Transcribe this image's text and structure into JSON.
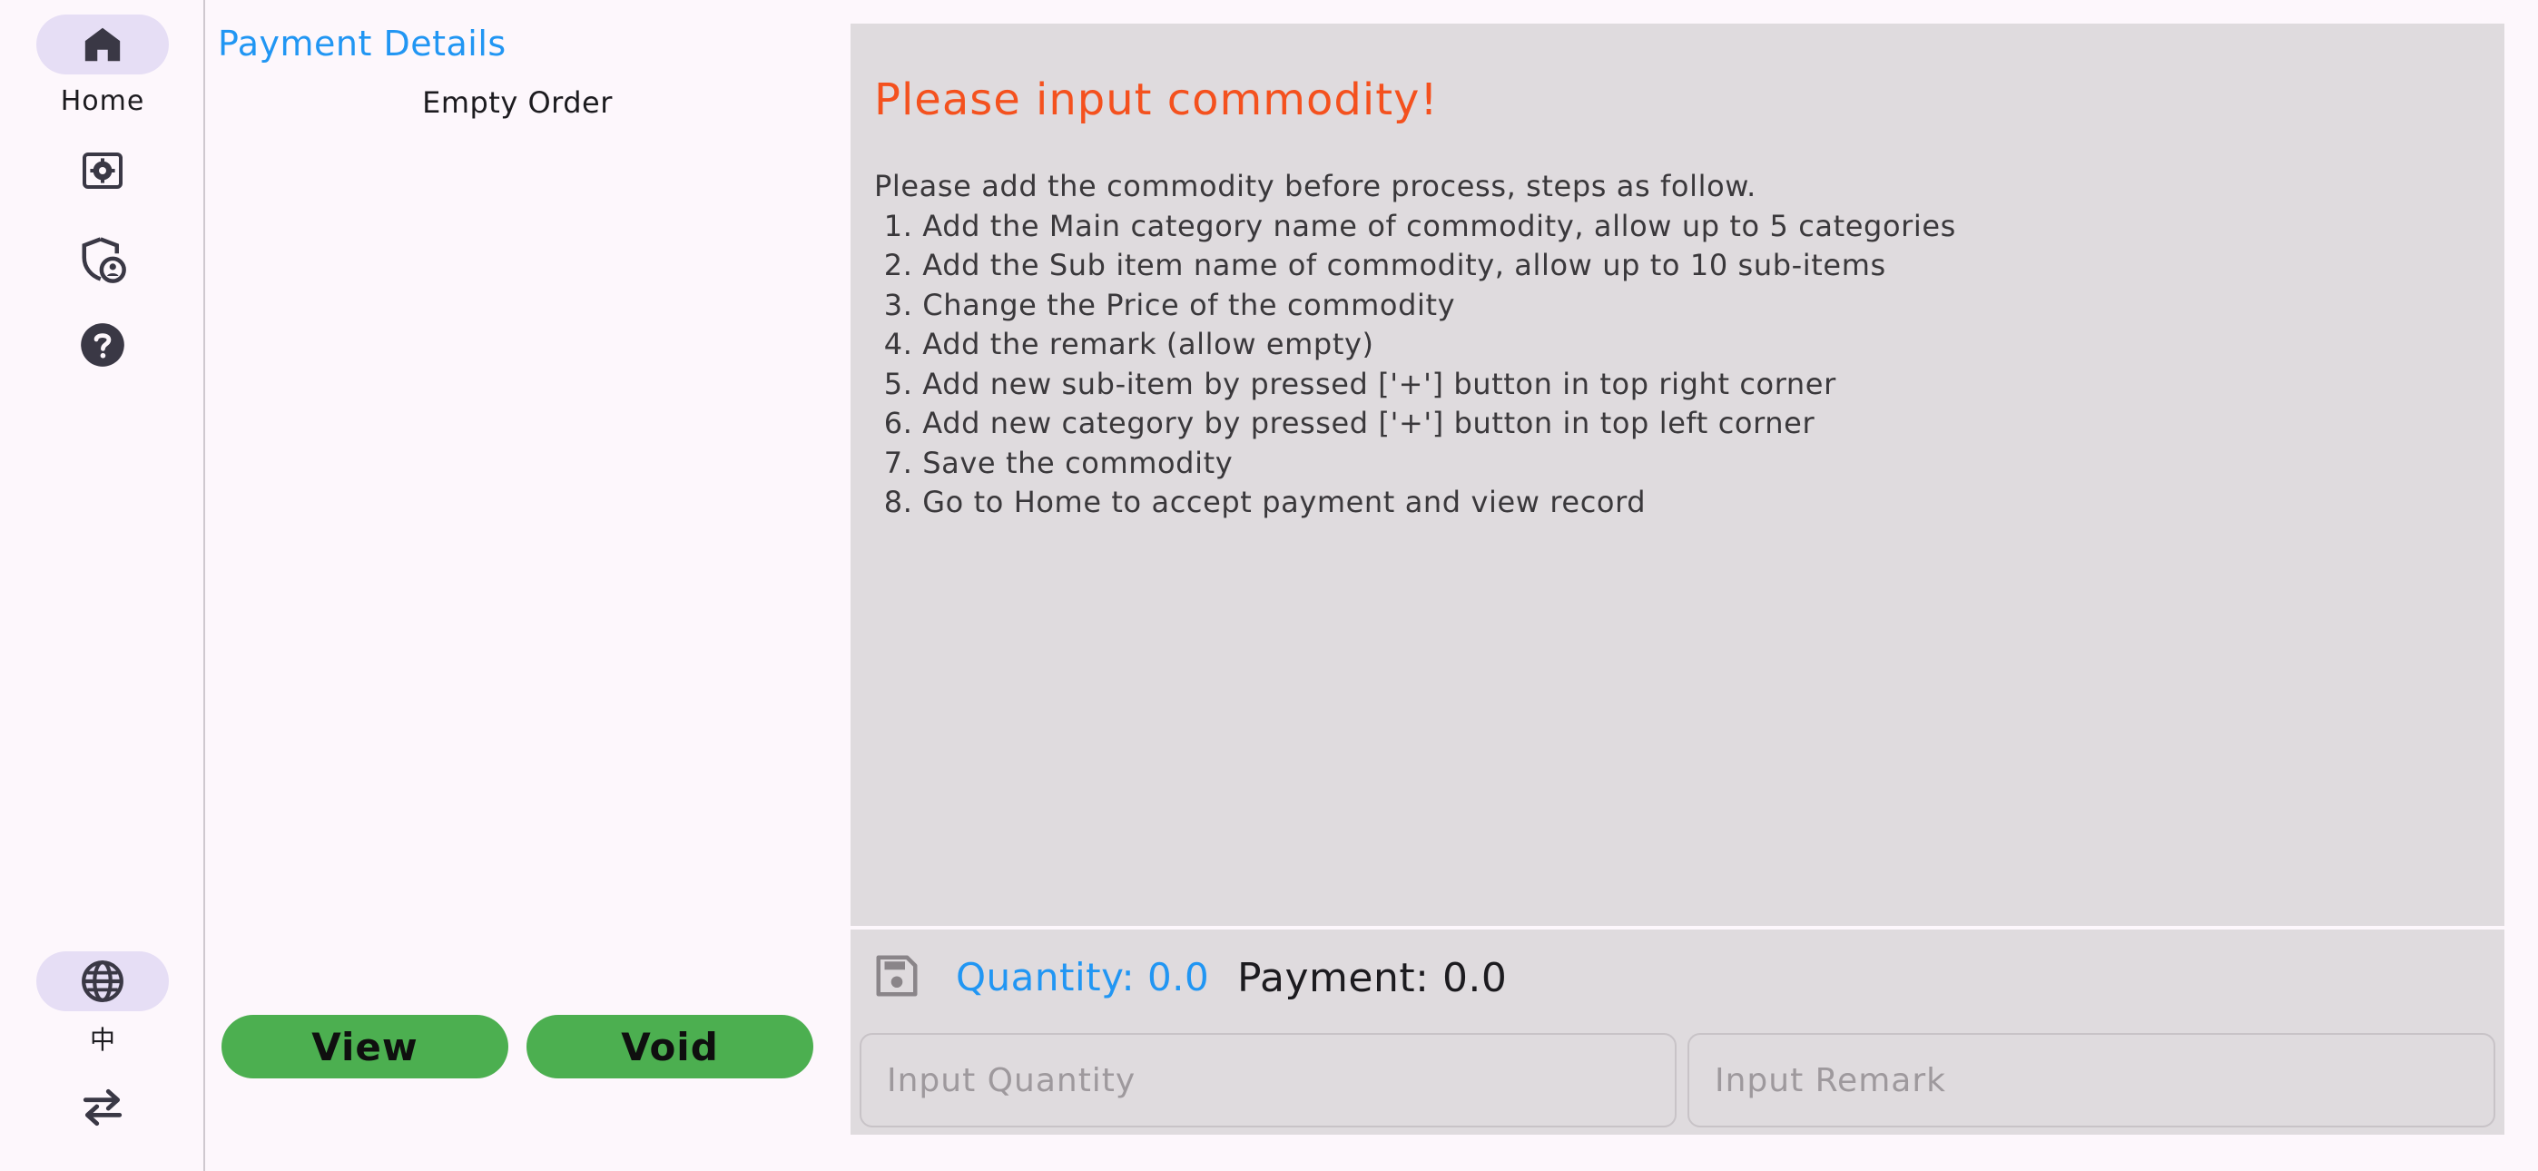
{
  "nav": {
    "home_label": "Home",
    "lang_label": "中",
    "icons": [
      "home-icon",
      "settings-icon",
      "admin-shield-icon",
      "help-icon",
      "globe-icon",
      "swap-icon"
    ],
    "accent_pill": "#e6def5"
  },
  "order_panel": {
    "title": "Payment Details",
    "empty_text": "Empty Order",
    "view_label": "View",
    "void_label": "Void",
    "button_color": "#4caf50"
  },
  "main": {
    "title": "Please input commodity!",
    "intro": "Please add the commodity before process, steps as follow.",
    "steps": [
      " 1. Add the Main category name of commodity, allow up to 5 categories",
      " 2. Add the Sub item name of commodity, allow up to 10 sub-items",
      " 3. Change the Price of the commodity",
      " 4. Add the remark (allow empty)",
      " 5. Add new sub-item by pressed ['+'] button in top right corner",
      " 6. Add new category by pressed ['+'] button in top left corner",
      " 7. Save the commodity",
      " 8. Go to Home to accept payment and view record"
    ],
    "title_color": "#f4511e"
  },
  "footer": {
    "quantity_text": "Quantity: 0.0",
    "payment_text": "Payment: 0.0",
    "quantity_placeholder": "Input Quantity",
    "remark_placeholder": "Input Remark",
    "accent_color": "#2196f3"
  }
}
